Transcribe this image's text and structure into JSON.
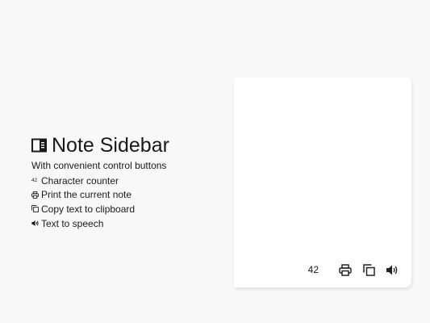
{
  "promo": {
    "title": "Note Sidebar",
    "subtitle": "With convenient control buttons",
    "features": [
      {
        "icon": "counter-icon",
        "icon_text": "42",
        "label": "Character counter"
      },
      {
        "icon": "printer-icon",
        "label": "Print the current note"
      },
      {
        "icon": "copy-icon",
        "label": "Copy text to clipboard"
      },
      {
        "icon": "speaker-icon",
        "label": "Text to speech"
      }
    ]
  },
  "panel": {
    "note_text": "",
    "character_count": "42",
    "buttons": [
      {
        "icon": "printer-icon",
        "action": "print"
      },
      {
        "icon": "copy-icon",
        "action": "copy"
      },
      {
        "icon": "speaker-icon",
        "action": "speak"
      }
    ]
  },
  "colors": {
    "page_background": "#f8f8f8",
    "panel_background": "#ffffff",
    "text": "#1a1a1a"
  }
}
